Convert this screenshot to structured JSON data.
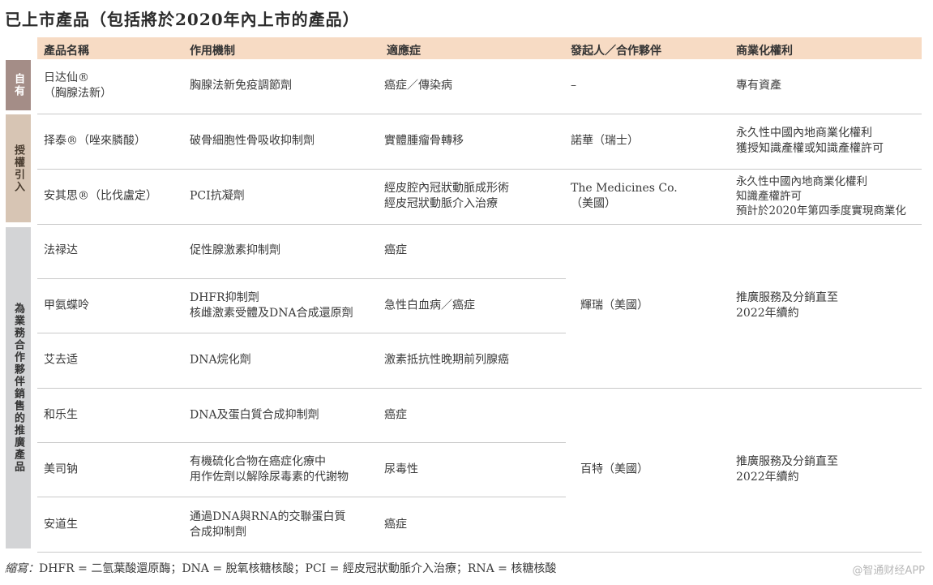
{
  "title": "已上市產品（包括將於2020年內上市的產品）",
  "headers": {
    "name": "產品名稱",
    "mechanism": "作用機制",
    "indication": "適應症",
    "partner": "發起人／合作夥伴",
    "rights": "商業化權利"
  },
  "groups": {
    "own": "自有",
    "licensed": "授權引入",
    "marketing": "為業務合作夥伴銷售的推廣產品"
  },
  "rows": [
    {
      "name": "日达仙®\n（胸腺法新）",
      "mechanism": "胸腺法新免疫調節劑",
      "indication": "癌症／傳染病",
      "partner": "–",
      "rights": "專有資產"
    },
    {
      "name": "择泰®（唑來膦酸）",
      "mechanism": "破骨細胞性骨吸收抑制劑",
      "indication": "實體腫瘤骨轉移",
      "partner": "諾華（瑞士）",
      "rights": "永久性中國內地商業化權利\n獲授知識產權或知識產權許可"
    },
    {
      "name": "安其思®（比伐盧定）",
      "mechanism": "PCI抗凝劑",
      "indication": "經皮腔內冠狀動脈成形術\n經皮冠狀動脈介入治療",
      "partner": "The Medicines Co.\n（美國）",
      "rights": "永久性中國內地商業化權利\n知識產權許可\n預計於2020年第四季度實現商業化"
    },
    {
      "name": "法禄达",
      "mechanism": "促性腺激素抑制劑",
      "indication": "癌症"
    },
    {
      "name": "甲氨蝶呤",
      "mechanism": "DHFR抑制劑\n核雌激素受體及DNA合成還原劑",
      "indication": "急性白血病／癌症"
    },
    {
      "name": "艾去适",
      "mechanism": "DNA烷化劑",
      "indication": "激素抵抗性晚期前列腺癌"
    },
    {
      "name": "和乐生",
      "mechanism": "DNA及蛋白質合成抑制劑",
      "indication": "癌症"
    },
    {
      "name": "美司钠",
      "mechanism": "有機硫化合物在癌症化療中\n用作佐劑以解除尿毒素的代謝物",
      "indication": "尿毒性"
    },
    {
      "name": "安道生",
      "mechanism": "通過DNA與RNA的交聯蛋白質\n合成抑制劑",
      "indication": "癌症"
    }
  ],
  "merged": [
    {
      "partner": "輝瑞（美國）",
      "rights": "推廣服務及分銷直至\n2022年續約"
    },
    {
      "partner": "百特（美國）",
      "rights": "推廣服務及分銷直至\n2022年續約"
    }
  ],
  "footer": {
    "label": "縮寫：",
    "text": "DHFR = 二氫葉酸還原酶；DNA = 脫氧核糖核酸；PCI = 經皮冠狀動脈介入治療；RNA = 核糖核酸"
  },
  "watermark": "@智通财经APP"
}
